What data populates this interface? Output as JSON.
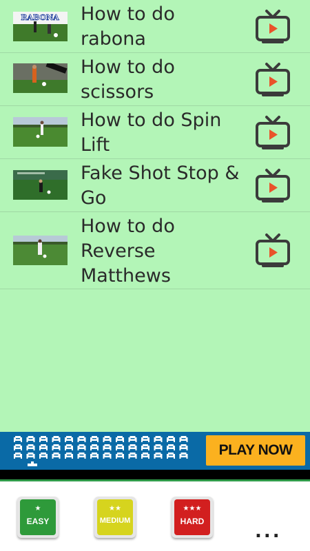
{
  "videos": [
    {
      "title": "How to do rabona",
      "thumb_overlay": "RABONA",
      "thumb_sky": "#ffffff",
      "thumb_ground": "#3f7a2a"
    },
    {
      "title": "How to do scissors",
      "thumb_overlay": "",
      "thumb_sky": "#6a6f63",
      "thumb_ground": "#3e7a2b"
    },
    {
      "title": "How to do Spin Lift",
      "thumb_overlay": "",
      "thumb_sky": "#b8c9d8",
      "thumb_ground": "#4a8a30"
    },
    {
      "title": "Fake Shot Stop & Go",
      "thumb_overlay": "",
      "thumb_sky": "#3a6b4a",
      "thumb_ground": "#2f6e2a"
    },
    {
      "title": "How to do Reverse Matthews",
      "thumb_overlay": "",
      "thumb_sky": "#b7cad6",
      "thumb_ground": "#4c8a35"
    }
  ],
  "ad": {
    "cta_label": "PLAY NOW",
    "background": "#0a6aa6",
    "cta_color": "#fbb11f"
  },
  "difficulty": [
    {
      "label": "EASY",
      "stars": "★",
      "color": "#2e9a3a"
    },
    {
      "label": "MEDIUM",
      "stars": "★★",
      "color": "#d6d41e"
    },
    {
      "label": "HARD",
      "stars": "★★★",
      "color": "#d21f1f"
    }
  ],
  "more_label": "...",
  "colors": {
    "background": "#b3f5b7",
    "tv_icon_outline": "#3b3b3b",
    "play_triangle": "#e9532a"
  }
}
